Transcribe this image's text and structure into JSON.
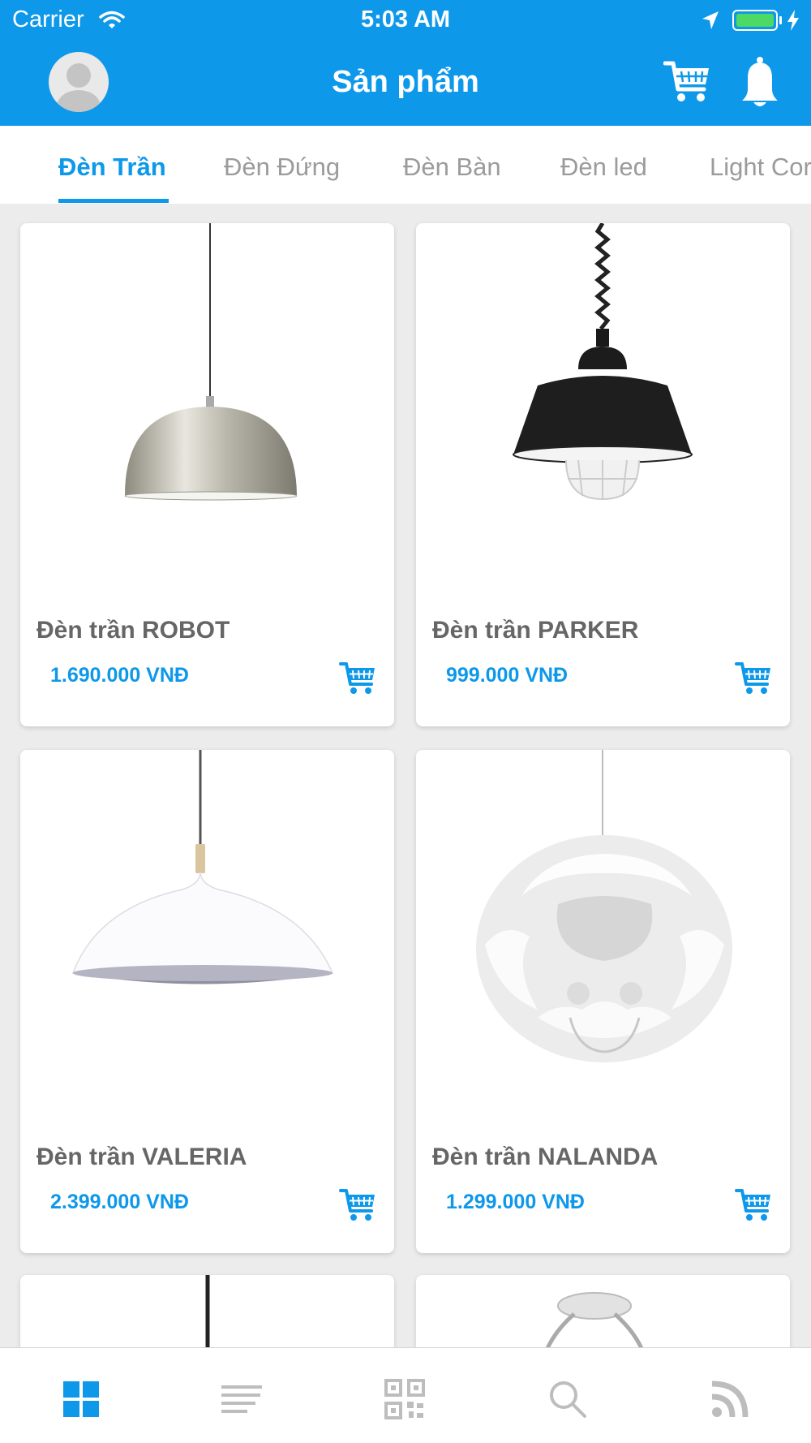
{
  "status_bar": {
    "carrier": "Carrier",
    "time": "5:03 AM",
    "icons": [
      "wifi-icon",
      "location-arrow-icon",
      "battery-icon",
      "charging-bolt-icon"
    ]
  },
  "nav": {
    "title": "Sản phẩm",
    "icons": [
      "avatar",
      "cart-icon",
      "bell-icon"
    ]
  },
  "tabs": [
    {
      "label": "Đèn Trần",
      "active": true
    },
    {
      "label": "Đèn Đứng",
      "active": false
    },
    {
      "label": "Đèn Bàn",
      "active": false
    },
    {
      "label": "Đèn led",
      "active": false
    },
    {
      "label": "Light Cor",
      "active": false
    }
  ],
  "products": [
    {
      "name": "Đèn trần ROBOT",
      "price": "1.690.000 VNĐ"
    },
    {
      "name": "Đèn trần PARKER",
      "price": "999.000 VNĐ"
    },
    {
      "name": "Đèn trần VALERIA",
      "price": "2.399.000 VNĐ"
    },
    {
      "name": "Đèn trần NALANDA",
      "price": "1.299.000 VNĐ"
    }
  ],
  "bottom_tabs": [
    {
      "icon": "grid-icon",
      "active": true
    },
    {
      "icon": "list-icon",
      "active": false
    },
    {
      "icon": "qr-code-icon",
      "active": false
    },
    {
      "icon": "search-icon",
      "active": false
    },
    {
      "icon": "rss-feed-icon",
      "active": false
    }
  ],
  "colors": {
    "accent": "#0e98ea",
    "background": "#ececec",
    "product_name": "#666666",
    "tab_inactive": "#9b9b9b"
  }
}
